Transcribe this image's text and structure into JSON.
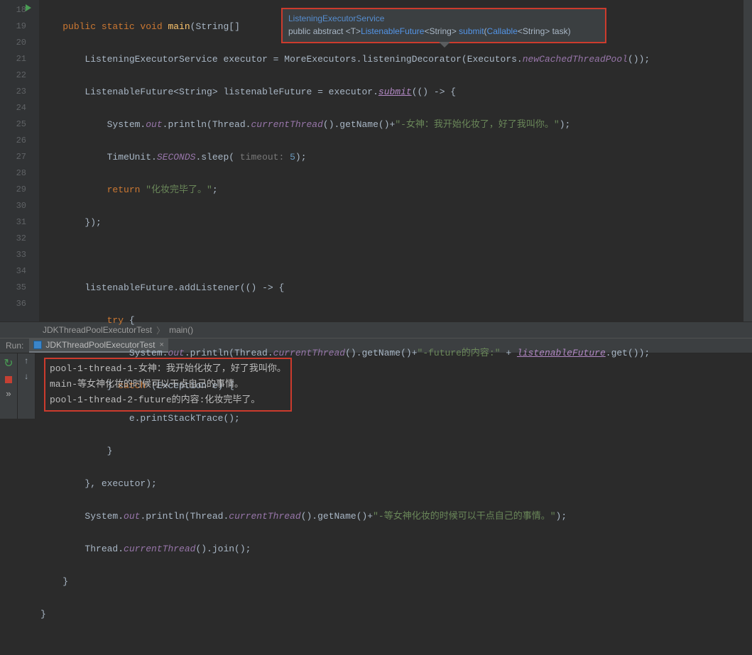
{
  "gutter": {
    "start": 18,
    "end": 36,
    "lines": [
      "18",
      "19",
      "20",
      "21",
      "22",
      "23",
      "24",
      "25",
      "26",
      "27",
      "28",
      "29",
      "30",
      "31",
      "32",
      "33",
      "34",
      "35",
      "36"
    ]
  },
  "code": {
    "l18_public": "public static void",
    "l18_main": " main",
    "l18_rest": "(String[] ",
    "l19_a": "ListeningExecutorService executor = MoreExecutors.listeningDecorator(Executors.",
    "l19_b": "newCachedThreadPool",
    "l19_c": "());",
    "l20_a": "ListenableFuture<String> listenableFuture = executor.",
    "l20_b": "submit",
    "l20_c": "(() -> {",
    "l21_a": "System.",
    "l21_b": "out",
    "l21_c": ".println(Thread.",
    "l21_d": "currentThread",
    "l21_e": "().getName()+",
    "l21_f": "\"-女神：我开始化妆了，好了我叫你。\"",
    "l21_g": ");",
    "l22_a": "TimeUnit.",
    "l22_b": "SECONDS",
    "l22_c": ".sleep( ",
    "l22_d": "timeout: ",
    "l22_e": "5",
    "l22_f": ");",
    "l23_a": "return ",
    "l23_b": "\"化妆完毕了。\"",
    "l23_c": ";",
    "l24": "});",
    "l26": "listenableFuture.addListener(() -> {",
    "l27_a": "try",
    "l27_b": " {",
    "l28_a": "System.",
    "l28_b": "out",
    "l28_c": ".println(Thread.",
    "l28_d": "currentThread",
    "l28_e": "().getName()+",
    "l28_f": "\"-future的内容:\"",
    "l28_g": " + ",
    "l28_h": "listenableFuture",
    "l28_i": ".get());",
    "l29_a": "} ",
    "l29_b": "catch",
    "l29_c": " (Exception e) {",
    "l30": "e.printStackTrace();",
    "l31": "}",
    "l32": "}, executor);",
    "l33_a": "System.",
    "l33_b": "out",
    "l33_c": ".println(Thread.",
    "l33_d": "currentThread",
    "l33_e": "().getName()+",
    "l33_f": "\"-等女神化妆的时候可以干点自己的事情。\"",
    "l33_g": ");",
    "l34_a": "Thread.",
    "l34_b": "currentThread",
    "l34_c": "().join();",
    "l35": "}",
    "l36": "}"
  },
  "tooltip": {
    "class": "ListeningExecutorService",
    "sig_pre": "public abstract ",
    "sig_gen": "<T>",
    "sig_type": "ListenableFuture",
    "sig_lt": "<String>",
    "sig_method": " submit",
    "sig_paren": "(",
    "sig_ptype": "Callable",
    "sig_pgen": "<String>",
    "sig_pname": " task)"
  },
  "breadcrumb": {
    "class": "JDKThreadPoolExecutorTest",
    "method": "main()"
  },
  "run": {
    "label": "Run:",
    "tab": "JDKThreadPoolExecutorTest",
    "faded_line": " ",
    "out1": "pool-1-thread-1-女神：我开始化妆了，好了我叫你。",
    "out2": "main-等女神化妆的时候可以干点自己的事情。",
    "out3": "pool-1-thread-2-future的内容:化妆完毕了。"
  }
}
